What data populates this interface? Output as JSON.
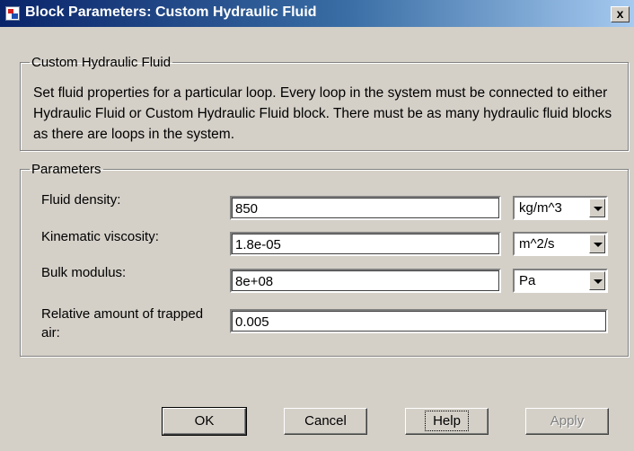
{
  "window": {
    "title": "Block Parameters: Custom Hydraulic Fluid",
    "close_label": "x"
  },
  "description_group": {
    "legend": "Custom Hydraulic Fluid",
    "text": "Set fluid properties for a particular loop. Every loop in the system must be connected to either Hydraulic Fluid or Custom Hydraulic Fluid block. There must be as many hydraulic fluid blocks as there are loops in the system."
  },
  "parameters": {
    "legend": "Parameters",
    "fluid_density": {
      "label": "Fluid density:",
      "value": "850",
      "unit": "kg/m^3"
    },
    "kinematic_viscosity": {
      "label": "Kinematic viscosity:",
      "value": "1.8e-05",
      "unit": "m^2/s"
    },
    "bulk_modulus": {
      "label": "Bulk modulus:",
      "value": "8e+08",
      "unit": "Pa"
    },
    "trapped_air": {
      "label_line1": "Relative amount of trapped",
      "label_line2": "air:",
      "value": "0.005"
    }
  },
  "buttons": {
    "ok": "OK",
    "cancel": "Cancel",
    "help": "Help",
    "apply": "Apply"
  }
}
